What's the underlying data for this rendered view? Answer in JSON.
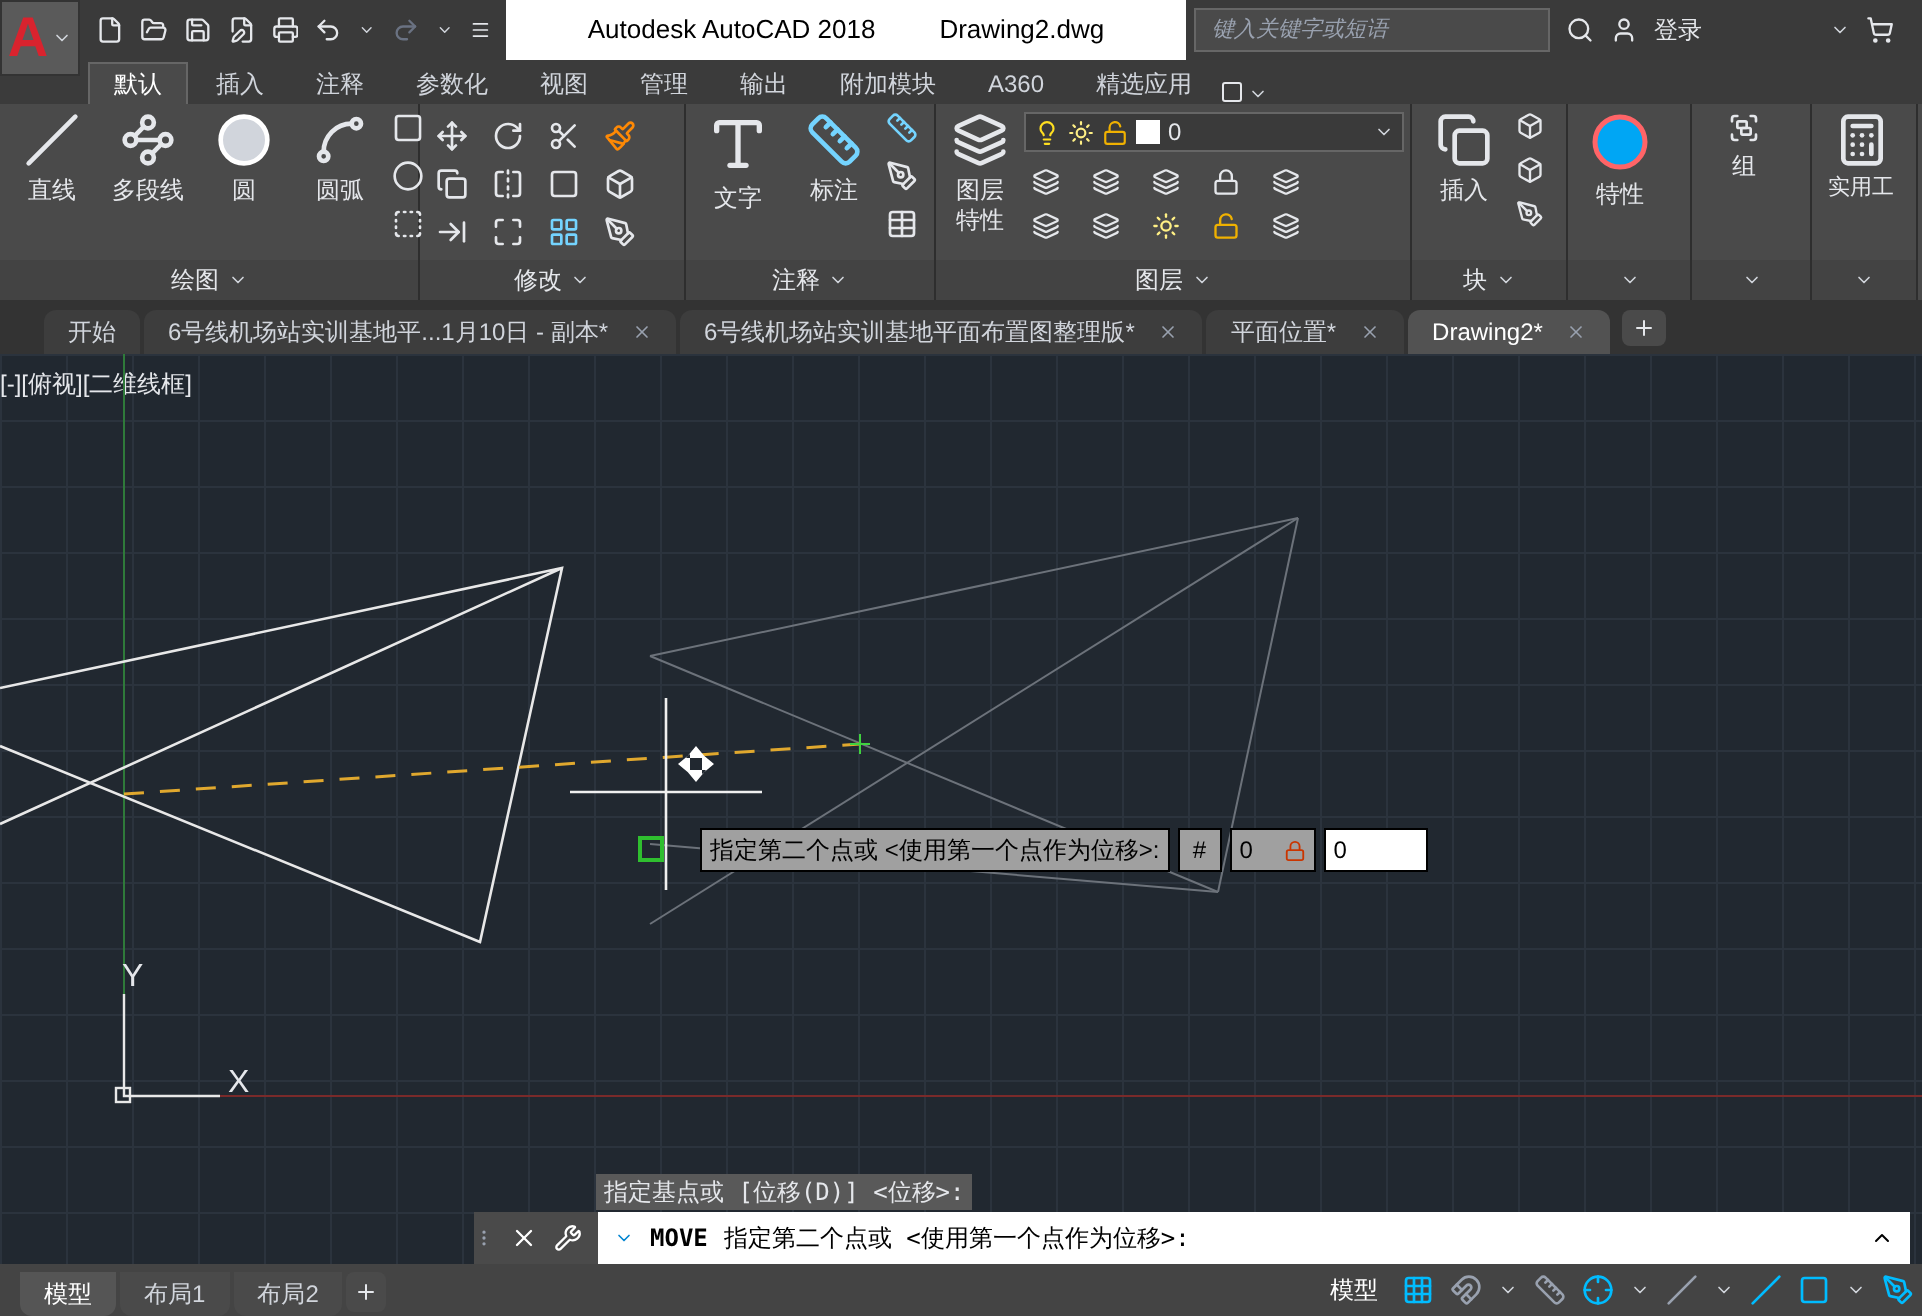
{
  "title_bar": {
    "app_logo": "A",
    "app_name": "Autodesk AutoCAD 2018",
    "file_name": "Drawing2.dwg",
    "search": {
      "placeholder": "键入关键字或短语"
    },
    "sign_in": "登录"
  },
  "ribbon_tabs": [
    {
      "label": "默认",
      "selected": true
    },
    {
      "label": "插入",
      "selected": false
    },
    {
      "label": "注释",
      "selected": false
    },
    {
      "label": "参数化",
      "selected": false
    },
    {
      "label": "视图",
      "selected": false
    },
    {
      "label": "管理",
      "selected": false
    },
    {
      "label": "输出",
      "selected": false
    },
    {
      "label": "附加模块",
      "selected": false
    },
    {
      "label": "A360",
      "selected": false
    },
    {
      "label": "精选应用",
      "selected": false
    }
  ],
  "ribbon_panels": [
    {
      "title": "绘图",
      "buttons": [
        "直线",
        "多段线",
        "圆",
        "圆弧"
      ]
    },
    {
      "title": "修改"
    },
    {
      "title": "注释",
      "buttons": [
        "文字",
        "标注"
      ]
    },
    {
      "title": "图层",
      "buttons": [
        "图层特性"
      ],
      "layer_dropdown": {
        "value": "0"
      }
    },
    {
      "title": "块",
      "buttons": [
        "插入"
      ]
    },
    {
      "buttons": [
        "特性"
      ]
    },
    {
      "buttons": [
        "组"
      ]
    },
    {
      "buttons": [
        "实用工"
      ]
    }
  ],
  "document_tabs": [
    {
      "label": "开始",
      "selected": false
    },
    {
      "label": "6号线机场站实训基地平...1月10日 - 副本*",
      "selected": false
    },
    {
      "label": "6号线机场站实训基地平面布置图整理版*",
      "selected": false
    },
    {
      "label": "平面位置*",
      "selected": false
    },
    {
      "label": "Drawing2*",
      "selected": true
    }
  ],
  "viewport": {
    "label": "[-][俯视][二维线框]",
    "axis_y": "Y",
    "axis_x": "X"
  },
  "dynamic_input": {
    "prompt": "指定第二个点或 <使用第一个点作为位移>:",
    "symbol": "#",
    "distance": "0",
    "value": "0"
  },
  "command_history": "指定基点或 [位移(D)] <位移>:",
  "command_line": {
    "command": "MOVE",
    "prompt": "指定第二个点或 <使用第一个点作为位移>:"
  },
  "layout_tabs": [
    {
      "label": "模型",
      "selected": true
    },
    {
      "label": "布局1",
      "selected": false
    },
    {
      "label": "布局2",
      "selected": false
    }
  ],
  "status_bar": {
    "space": "模型"
  }
}
